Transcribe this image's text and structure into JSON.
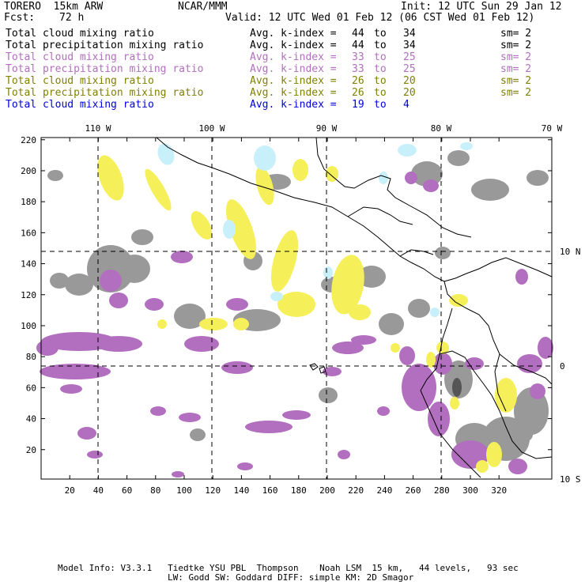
{
  "header": {
    "model_title": "TORERO  15km ARW",
    "org": "NCAR/MMM",
    "init": "Init: 12 UTC Sun 29 Jan 12",
    "fcst_label": "Fcst:",
    "fcst_value": "72 h",
    "valid": "Valid: 12 UTC Wed 01 Feb 12 (06 CST Wed 01 Feb 12)"
  },
  "legend": [
    {
      "field": "Total cloud mixing ratio",
      "kindex": "Avg. k-index =",
      "from": "44",
      "to_word": "to",
      "to": "34",
      "sm": "sm= 2",
      "color": "#000000"
    },
    {
      "field": "Total precipitation mixing ratio",
      "kindex": "Avg. k-index =",
      "from": "44",
      "to_word": "to",
      "to": "34",
      "sm": "sm= 2",
      "color": "#000000"
    },
    {
      "field": "Total cloud mixing ratio",
      "kindex": "Avg. k-index =",
      "from": "33",
      "to_word": "to",
      "to": "25",
      "sm": "sm= 2",
      "color": "#b36fbf"
    },
    {
      "field": "Total precipitation mixing ratio",
      "kindex": "Avg. k-index =",
      "from": "33",
      "to_word": "to",
      "to": "25",
      "sm": "sm= 2",
      "color": "#b36fbf"
    },
    {
      "field": "Total cloud mixing ratio",
      "kindex": "Avg. k-index =",
      "from": "26",
      "to_word": "to",
      "to": "20",
      "sm": "sm= 2",
      "color": "#808000"
    },
    {
      "field": "Total precipitation mixing ratio",
      "kindex": "Avg. k-index =",
      "from": "26",
      "to_word": "to",
      "to": "20",
      "sm": "sm= 2",
      "color": "#808000"
    },
    {
      "field": "Total cloud mixing ratio",
      "kindex": "Avg. k-index =",
      "from": "19",
      "to_word": "to",
      "to": "4",
      "sm": "",
      "color": "#0000dd"
    }
  ],
  "axes": {
    "top_lon_labels": [
      "110 W",
      "100 W",
      "90 W",
      "80 W",
      "70 W"
    ],
    "right_lat_labels": [
      "10 N",
      "0",
      "10 S"
    ],
    "left_y_ticks": [
      "220",
      "200",
      "180",
      "160",
      "140",
      "120",
      "100",
      "80",
      "60",
      "40",
      "20"
    ],
    "bottom_x_ticks": [
      "20",
      "40",
      "60",
      "80",
      "100",
      "120",
      "140",
      "160",
      "180",
      "200",
      "220",
      "240",
      "260",
      "280",
      "300",
      "320"
    ]
  },
  "footer": {
    "line1": "Model Info: V3.3.1   Tiedtke YSU PBL  Thompson    Noah LSM  15 km,   44 levels,   93 sec",
    "line2": "LW: Godd SW: Goddard DIFF: simple KM: 2D Smagor"
  },
  "colors": {
    "gray": "#999999",
    "dark_gray": "#555555",
    "purple": "#b36fbf",
    "yellow": "#f5f05a",
    "light_blue": "#c8f0fa"
  }
}
